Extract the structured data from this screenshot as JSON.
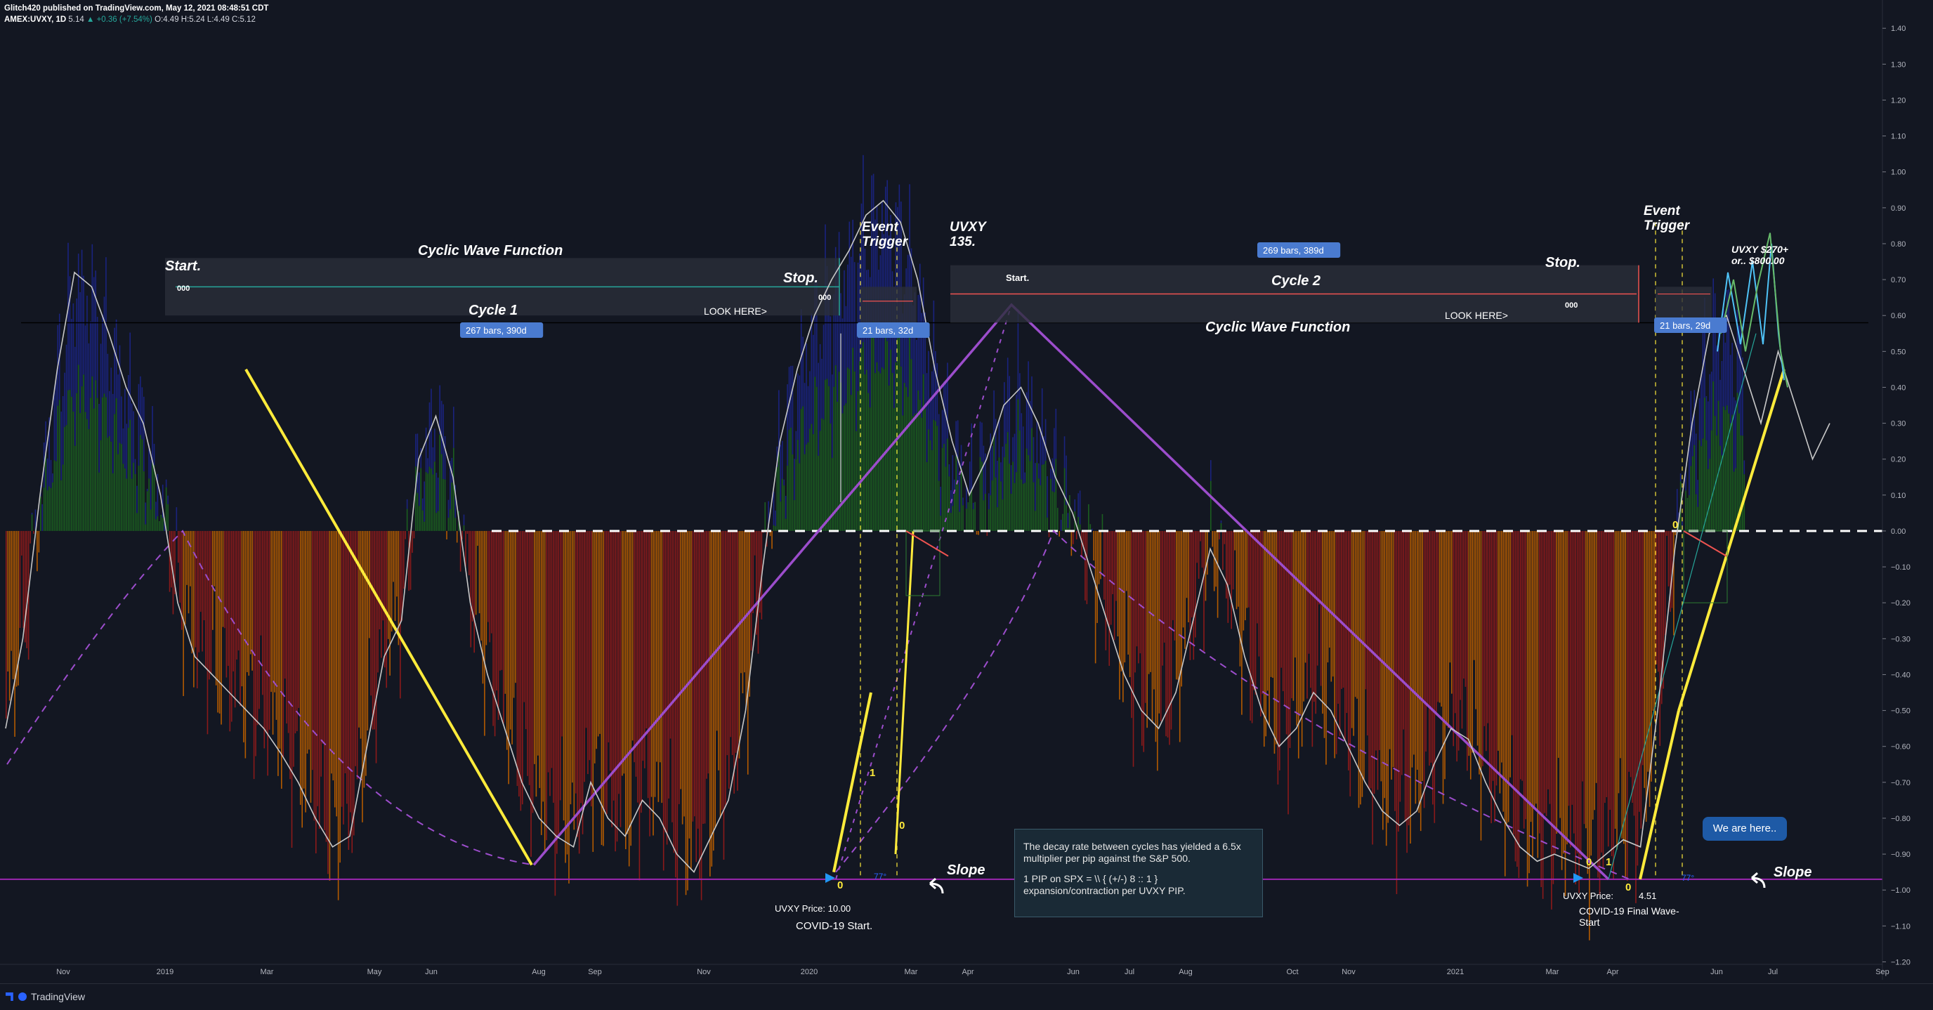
{
  "header": {
    "published": "Glitch420 published on TradingView.com, May 12, 2021 08:48:51 CDT",
    "symbol": "AMEX:UVXY, 1D",
    "last": "5.14",
    "change": "+0.36 (+7.54%)",
    "ohlc": "O:4.49 H:5.24 L:4.49 C:5.12"
  },
  "footer": {
    "brand": "TradingView"
  },
  "chart_data": {
    "type": "bar",
    "title": "",
    "y_axis": {
      "ticks": [
        "1.40",
        "1.30",
        "1.20",
        "1.10",
        "1.00",
        "0.90",
        "0.80",
        "0.70",
        "0.60",
        "0.50",
        "0.40",
        "0.30",
        "0.20",
        "0.10",
        "0.00",
        "−0.10",
        "−0.20",
        "−0.30",
        "−0.40",
        "−0.50",
        "−0.60",
        "−0.70",
        "−0.80",
        "−0.90",
        "−1.00",
        "−1.10",
        "−1.20"
      ],
      "ylim": [
        -1.25,
        1.42
      ]
    },
    "x_axis": {
      "ticks": [
        "Nov",
        "2019",
        "Mar",
        "May",
        "Jun",
        "Aug",
        "Sep",
        "Nov",
        "2020",
        "Mar",
        "Apr",
        "Jun",
        "Jul",
        "Aug",
        "Oct",
        "Nov",
        "2021",
        "Mar",
        "Apr",
        "Jun",
        "Jul",
        "Sep"
      ]
    },
    "oscillator_series": {
      "name": "",
      "x_index": [
        0,
        10,
        20,
        30,
        40,
        50,
        60,
        70,
        80,
        90,
        100,
        110,
        120,
        130,
        140,
        150,
        160,
        170,
        180,
        190,
        200,
        210,
        220,
        230,
        240,
        250,
        260,
        270,
        280,
        290,
        300,
        310,
        320,
        330,
        340,
        350,
        360,
        370,
        380,
        390,
        400,
        410,
        420,
        430,
        440,
        450,
        460,
        470,
        480,
        490,
        500,
        510,
        520,
        530,
        540,
        550,
        560,
        570,
        580,
        590,
        600,
        610,
        620,
        630,
        640,
        650,
        660,
        670,
        680,
        690,
        700,
        710,
        720,
        730,
        740,
        750,
        760,
        770,
        780,
        790,
        800,
        810,
        820,
        830,
        840,
        850,
        860,
        870,
        880,
        890,
        900,
        910,
        920,
        930,
        940,
        950,
        960,
        970,
        980,
        990,
        1000,
        1010,
        1020,
        1030,
        1040,
        1050,
        1060
      ],
      "values": [
        -0.55,
        -0.3,
        0.1,
        0.45,
        0.72,
        0.68,
        0.55,
        0.4,
        0.3,
        0.1,
        -0.2,
        -0.35,
        -0.4,
        -0.45,
        -0.5,
        -0.55,
        -0.62,
        -0.7,
        -0.8,
        -0.88,
        -0.85,
        -0.6,
        -0.35,
        -0.25,
        0.2,
        0.32,
        0.15,
        -0.2,
        -0.4,
        -0.55,
        -0.7,
        -0.8,
        -0.85,
        -0.88,
        -0.7,
        -0.8,
        -0.85,
        -0.75,
        -0.8,
        -0.9,
        -0.95,
        -0.85,
        -0.75,
        -0.5,
        -0.1,
        0.25,
        0.45,
        0.6,
        0.7,
        0.78,
        0.88,
        0.92,
        0.86,
        0.7,
        0.45,
        0.25,
        0.1,
        0.2,
        0.35,
        0.4,
        0.3,
        0.15,
        0.05,
        -0.1,
        -0.25,
        -0.4,
        -0.5,
        -0.55,
        -0.45,
        -0.25,
        -0.05,
        -0.15,
        -0.35,
        -0.5,
        -0.6,
        -0.55,
        -0.45,
        -0.5,
        -0.6,
        -0.7,
        -0.78,
        -0.82,
        -0.78,
        -0.65,
        -0.55,
        -0.58,
        -0.7,
        -0.8,
        -0.88,
        -0.92,
        -0.9,
        -0.92,
        -0.94,
        -0.9,
        -0.86,
        -0.88,
        -0.5,
        -0.05,
        0.3,
        0.55,
        0.6,
        0.45,
        0.3,
        0.5,
        0.35,
        0.2,
        0.3
      ],
      "color": "#c8c8c8"
    },
    "histogram": {
      "positive_colors": [
        "#1a237e",
        "#1b5e20"
      ],
      "negative_colors": [
        "#8b1a1a",
        "#b35a00"
      ]
    },
    "annotations": [
      {
        "text": "Start.",
        "color": "#ffffff"
      },
      {
        "text": "000"
      },
      {
        "text": "Cyclic Wave Function"
      },
      {
        "text": "Stop."
      },
      {
        "text": "000"
      },
      {
        "text": "Cycle 1"
      },
      {
        "text": "LOOK HERE>"
      },
      {
        "text": "267 bars, 390d"
      },
      {
        "text": "Event Trigger"
      },
      {
        "text": "21 bars, 32d"
      },
      {
        "text": "UVXY 135."
      },
      {
        "text": "Start."
      },
      {
        "text": "269 bars, 389d"
      },
      {
        "text": "Cycle 2"
      },
      {
        "text": "Stop."
      },
      {
        "text": "000"
      },
      {
        "text": "LOOK HERE>"
      },
      {
        "text": "Cyclic Wave Function"
      },
      {
        "text": "Event Trigger"
      },
      {
        "text": "21 bars, 29d"
      },
      {
        "text": "UVXY $270+ or.. $800.00"
      },
      {
        "text": "Slope"
      },
      {
        "text": "Slope"
      },
      {
        "text": "UVXY Price:   10.00"
      },
      {
        "text": "COVID-19 Start."
      },
      {
        "text": "UVXY Price:"
      },
      {
        "text": "4.51"
      },
      {
        "text": "COVID-19 Final Wave-Start"
      },
      {
        "text": "77°"
      },
      {
        "text": "77°"
      },
      {
        "text": "0"
      },
      {
        "text": "1"
      },
      {
        "text": "0"
      },
      {
        "text": "0"
      },
      {
        "text": "1"
      },
      {
        "text": "0"
      },
      {
        "text": "0"
      }
    ],
    "info_box": [
      "The decay rate between cycles has yielded a 6.5x multiplier per pip against the S&P 500.",
      "1 PIP on SPX = \\\\  { (+/-)  8 :: 1 }  expansion/contraction per UVXY PIP."
    ],
    "callout": "We are here..",
    "colors": {
      "background": "#131722",
      "zero_line": "#ffffff",
      "purple": "#9c4dcc",
      "yellow": "#ffeb3b",
      "baseline": "#9c27b0"
    }
  }
}
